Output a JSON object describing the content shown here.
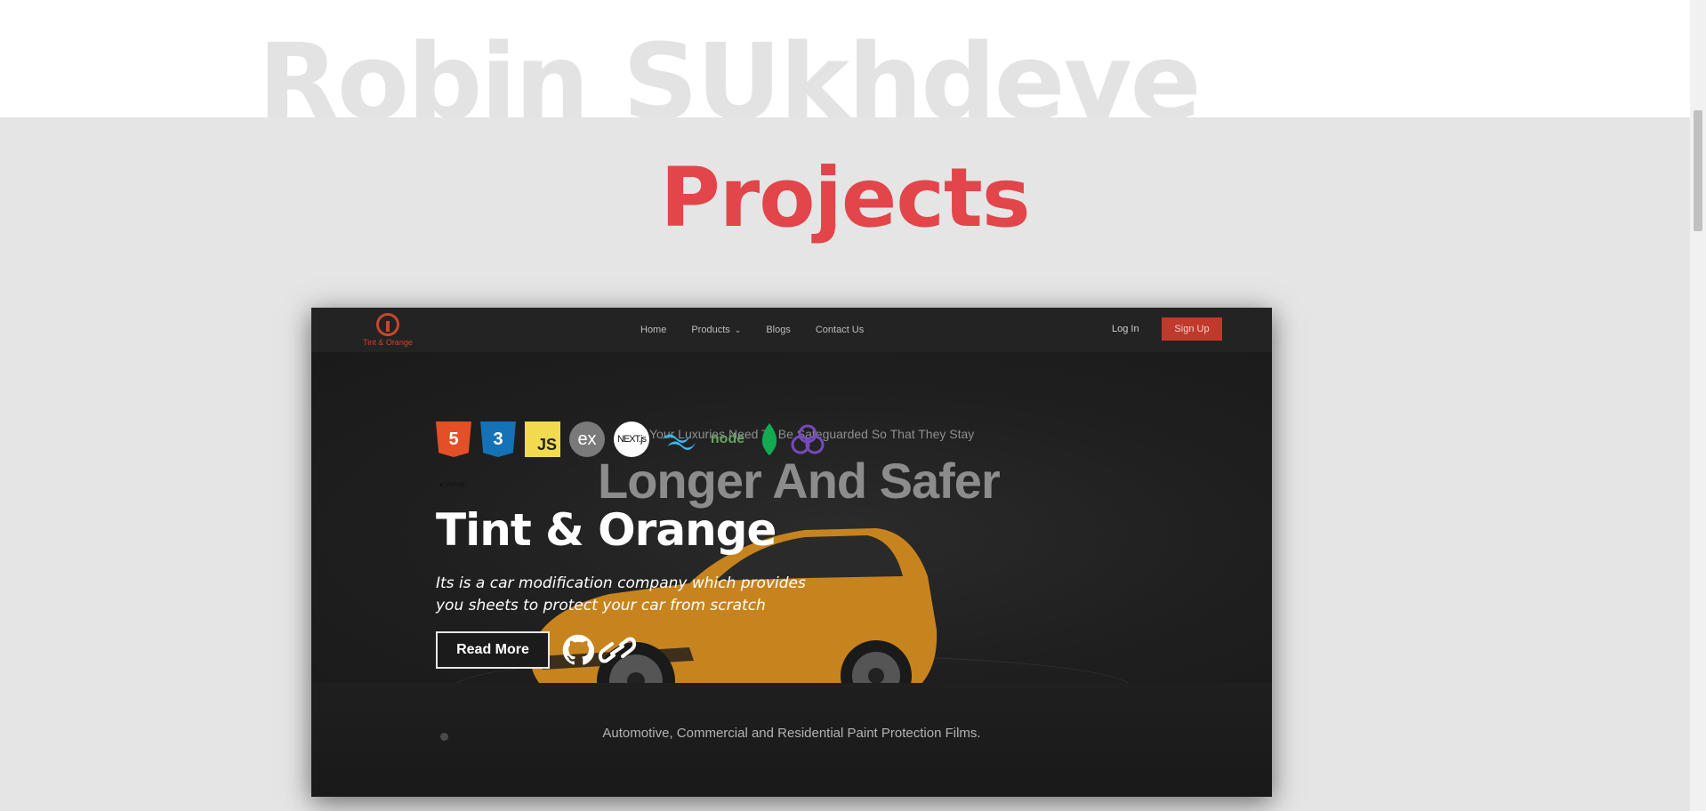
{
  "background_name": "Robin SUkhdeve",
  "section_title": "Projects",
  "colors": {
    "accent": "#e2454a",
    "site_brand": "#c0392b",
    "car": "#c7841e"
  },
  "project": {
    "title": "Tint & Orange",
    "description": "Its is a car modification company which provides you sheets to protect your car from scratch",
    "read_more": "Read More",
    "tech_stack": [
      {
        "name": "html5-icon",
        "label": "5"
      },
      {
        "name": "css3-icon",
        "label": "3"
      },
      {
        "name": "javascript-icon",
        "label": "JS"
      },
      {
        "name": "express-icon",
        "label": "ex"
      },
      {
        "name": "nextjs-icon",
        "label": "NEXT.js"
      },
      {
        "name": "tailwind-icon",
        "label": ""
      },
      {
        "name": "nodejs-icon",
        "label": "node"
      },
      {
        "name": "mongodb-icon",
        "label": ""
      },
      {
        "name": "redux-icon",
        "label": ""
      }
    ],
    "hosting": "▲Vercel",
    "links": {
      "github": "github-icon",
      "live": "link-icon"
    }
  },
  "screenshot_site": {
    "logo_text": "Tint & Orange",
    "nav": [
      "Home",
      "Products",
      "Blogs",
      "Contact Us"
    ],
    "login": "Log In",
    "signup": "Sign Up",
    "hero_tagline": "Your Luxuries Need To Be Safeguarded So That They Stay",
    "hero_heading": "Longer And Safer",
    "feature_text": "Automotive, Commercial and Residential Paint Protection Films."
  }
}
